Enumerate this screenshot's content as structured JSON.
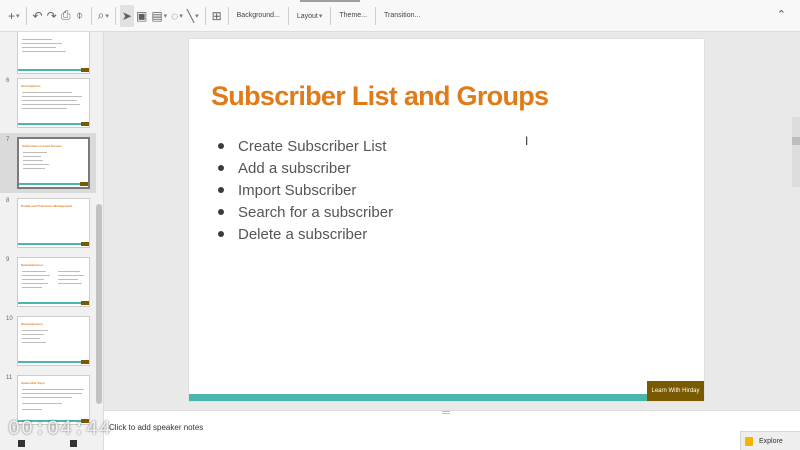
{
  "toolbar": {
    "background_label": "Background...",
    "layout_label": "Layout",
    "theme_label": "Theme...",
    "transition_label": "Transition..."
  },
  "filmstrip": {
    "slides": [
      {
        "number": "6",
        "title": "Send Options"
      },
      {
        "number": "7",
        "title": "Subscriber List and Groups"
      },
      {
        "number": "8",
        "title": "Profile and Preference Management"
      },
      {
        "number": "9",
        "title": "Data Extension"
      },
      {
        "number": "10",
        "title": "Data Extension"
      },
      {
        "number": "11",
        "title": "Subscriber Keys"
      }
    ]
  },
  "slide": {
    "title": "Subscriber List and Groups",
    "bullets": [
      "Create Subscriber List",
      "Add a subscriber",
      "Import Subscriber",
      "Search for a subscriber",
      "Delete a subscriber"
    ],
    "badge": "Learn With Hirday"
  },
  "notes": {
    "placeholder": "Click to add speaker notes"
  },
  "explore": {
    "label": "Explore"
  },
  "overlay": {
    "timestamp": "00:04:44"
  },
  "colors": {
    "title": "#e07b1a",
    "footer_bar": "#4db6ac",
    "badge": "#7a5a00",
    "explore_icon": "#f4b400"
  }
}
